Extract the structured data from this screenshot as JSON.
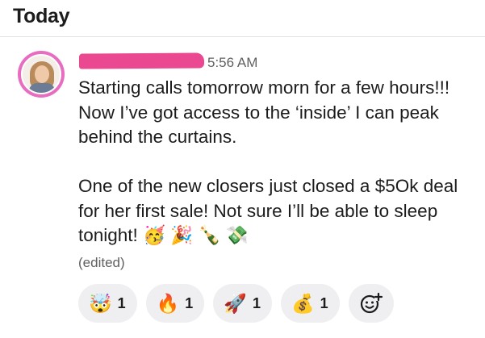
{
  "header": {
    "day": "Today"
  },
  "message": {
    "timestamp": "5:56 AM",
    "paragraph_1": "Starting calls tomorrow morn for a few hours!!! Now I’ve got access to the ‘inside’ I can peak behind the curtains.",
    "paragraph_2_text": "One of the new closers just closed a $5Ok deal for her first sale! Not sure I’ll be able to sleep tonight!",
    "paragraph_2_emojis": "🥳 🎉 🍾 💸",
    "edited_label": "(edited)",
    "avatar_ring_color": "#e86cc0",
    "redaction_color": "#ea4891"
  },
  "reactions": [
    {
      "emoji": "🤯",
      "icon": "exploding-head-icon",
      "count": "1"
    },
    {
      "emoji": "🔥",
      "icon": "fire-icon",
      "count": "1"
    },
    {
      "emoji": "🚀",
      "icon": "rocket-icon",
      "count": "1"
    },
    {
      "emoji": "💰",
      "icon": "money-bag-icon",
      "count": "1"
    }
  ],
  "add_reaction_icon": "add-emoji-icon"
}
